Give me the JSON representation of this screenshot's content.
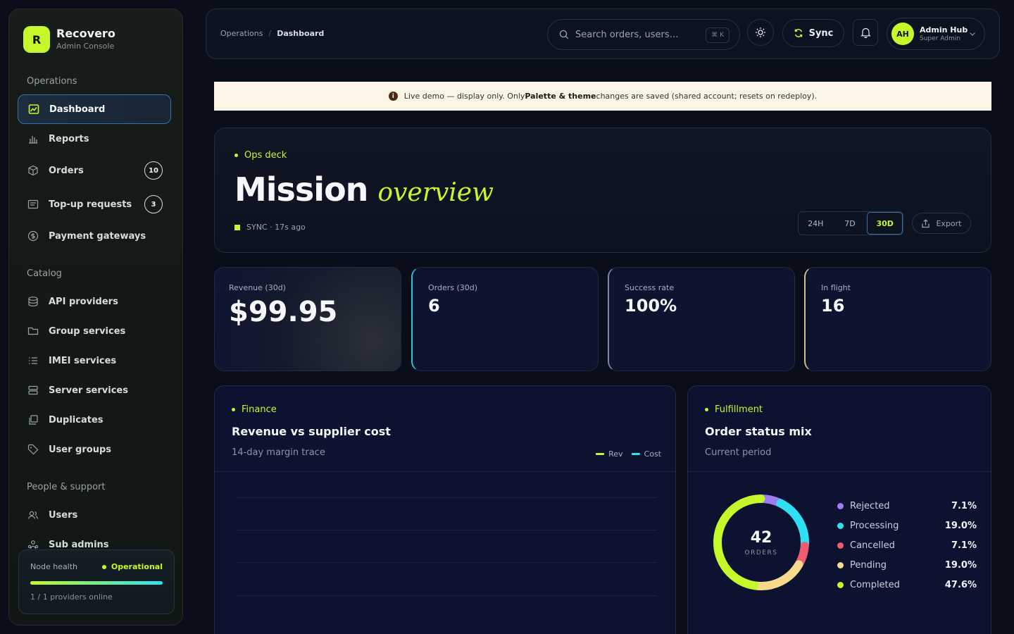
{
  "brand": {
    "name": "Recovero",
    "subtitle": "Admin Console",
    "logo_letter": "R"
  },
  "sidebar": {
    "sections": [
      {
        "label": "Operations"
      },
      {
        "label": "Catalog"
      },
      {
        "label": "People & support"
      }
    ],
    "items": [
      {
        "label": "Dashboard",
        "icon": "chart-image-icon",
        "active": true
      },
      {
        "label": "Reports",
        "icon": "bar-chart-icon"
      },
      {
        "label": "Orders",
        "icon": "package-icon",
        "badge": "10"
      },
      {
        "label": "Top-up requests",
        "icon": "receipt-icon",
        "badge": "3"
      },
      {
        "label": "Payment gateways",
        "icon": "dollar-circle-icon"
      },
      {
        "label": "API providers",
        "icon": "database-icon"
      },
      {
        "label": "Group services",
        "icon": "folder-icon"
      },
      {
        "label": "IMEI services",
        "icon": "list-check-icon"
      },
      {
        "label": "Server services",
        "icon": "server-icon"
      },
      {
        "label": "Duplicates",
        "icon": "copy-icon"
      },
      {
        "label": "User groups",
        "icon": "tag-icon"
      },
      {
        "label": "Users",
        "icon": "users-icon"
      },
      {
        "label": "Sub admins",
        "icon": "user-network-icon"
      }
    ],
    "node_health": {
      "title": "Node health",
      "status": "Operational",
      "progress": 1.0,
      "footer": "1 / 1 providers online"
    }
  },
  "topbar": {
    "breadcrumb": [
      "Operations",
      "Dashboard"
    ],
    "search_placeholder": "Search orders, users…",
    "search_shortcut": "⌘ K",
    "sync_label": "Sync",
    "user": {
      "initials": "AH",
      "name": "Admin Hub",
      "role": "Super Admin"
    }
  },
  "banner": {
    "icon": "i",
    "text_before": "Live demo — display only. Only ",
    "text_bold": "Palette & theme",
    "text_after": " changes are saved (shared account; resets on redeploy)."
  },
  "hero": {
    "eyebrow": "Ops deck",
    "title": "Mission",
    "title_accent": "overview",
    "sync_status": "SYNC · 17s ago",
    "ranges": [
      "24H",
      "7D",
      "30D"
    ],
    "active_range": "30D",
    "export_label": "Export"
  },
  "kpis": [
    {
      "label": "Revenue (30d)",
      "value": "$99.95"
    },
    {
      "label": "Orders (30d)",
      "value": "6"
    },
    {
      "label": "Success rate",
      "value": "100%"
    },
    {
      "label": "In flight",
      "value": "16"
    }
  ],
  "finance": {
    "eyebrow": "Finance",
    "title": "Revenue vs supplier cost",
    "subtitle": "14-day margin trace",
    "legend": [
      {
        "name": "Rev",
        "color": "#c4f82a"
      },
      {
        "name": "Cost",
        "color": "#2ee0f2"
      }
    ]
  },
  "fulfillment": {
    "eyebrow": "Fulfillment",
    "title": "Order status mix",
    "subtitle": "Current period",
    "total": "42",
    "total_caption": "ORDERS",
    "segments": [
      {
        "name": "Rejected",
        "pct": "7.1%",
        "value": 7.1,
        "color": "#a07cf2"
      },
      {
        "name": "Processing",
        "pct": "19.0%",
        "value": 19.0,
        "color": "#2ee0f2"
      },
      {
        "name": "Cancelled",
        "pct": "7.1%",
        "value": 7.1,
        "color": "#ef5a6f"
      },
      {
        "name": "Pending",
        "pct": "19.0%",
        "value": 19.0,
        "color": "#f6d98a"
      },
      {
        "name": "Completed",
        "pct": "47.6%",
        "value": 47.6,
        "color": "#c4f82a"
      }
    ]
  },
  "colors": {
    "accent": "#c4f82a",
    "cyan": "#2ee0f2",
    "bg": "#0a0e1a"
  }
}
